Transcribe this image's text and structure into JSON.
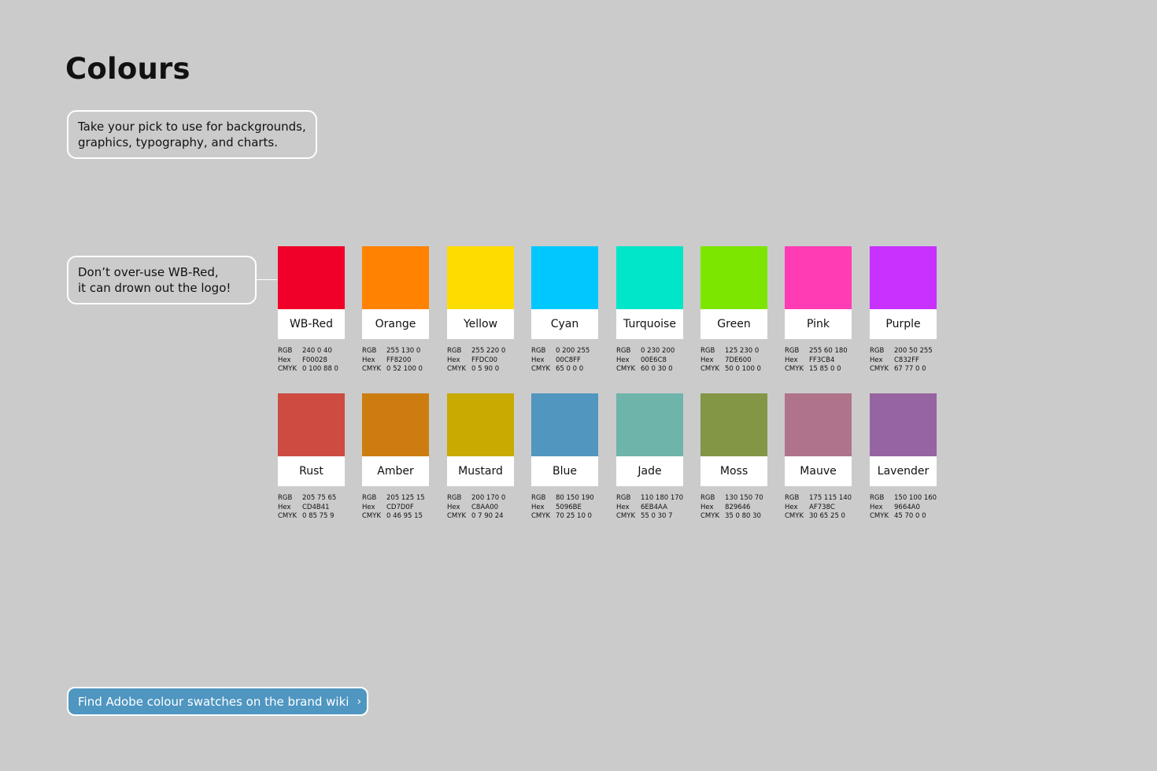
{
  "page": {
    "title": "Colours",
    "intro_lines": [
      "Take your pick to use for backgrounds,",
      "graphics, typography, and charts."
    ],
    "warning_lines": [
      "Don’t over-use WB-Red,",
      "it can drown out the logo!"
    ],
    "wiki_link": "Find Adobe colour swatches on the brand wiki",
    "wiki_chevron": "›"
  },
  "spec_labels": {
    "rgb": "RGB",
    "hex": "Hex",
    "cmyk": "CMYK"
  },
  "swatches": [
    {
      "name": "WB-Red",
      "color": "#F00028",
      "rgb": "240 0 40",
      "hex": "F00028",
      "cmyk": "0 100 88 0"
    },
    {
      "name": "Orange",
      "color": "#FF8200",
      "rgb": "255 130 0",
      "hex": "FF8200",
      "cmyk": "0 52 100 0"
    },
    {
      "name": "Yellow",
      "color": "#FFDC00",
      "rgb": "255 220 0",
      "hex": "FFDC00",
      "cmyk": "0 5 90 0"
    },
    {
      "name": "Cyan",
      "color": "#00C8FF",
      "rgb": "0 200 255",
      "hex": "00C8FF",
      "cmyk": "65 0 0 0"
    },
    {
      "name": "Turquoise",
      "color": "#00E6C8",
      "rgb": "0 230 200",
      "hex": "00E6C8",
      "cmyk": "60 0 30 0"
    },
    {
      "name": "Green",
      "color": "#7DE600",
      "rgb": "125 230 0",
      "hex": "7DE600",
      "cmyk": "50 0 100 0"
    },
    {
      "name": "Pink",
      "color": "#FF3CB4",
      "rgb": "255 60 180",
      "hex": "FF3CB4",
      "cmyk": "15 85 0 0"
    },
    {
      "name": "Purple",
      "color": "#C832FF",
      "rgb": "200 50 255",
      "hex": "C832FF",
      "cmyk": "67 77 0 0"
    },
    {
      "name": "Rust",
      "color": "#CD4B41",
      "rgb": "205 75 65",
      "hex": "CD4B41",
      "cmyk": "0 85 75 9"
    },
    {
      "name": "Amber",
      "color": "#CD7D0F",
      "rgb": "205 125 15",
      "hex": "CD7D0F",
      "cmyk": "0 46 95 15"
    },
    {
      "name": "Mustard",
      "color": "#C8AA00",
      "rgb": "200 170 0",
      "hex": "C8AA00",
      "cmyk": "0 7 90 24"
    },
    {
      "name": "Blue",
      "color": "#5096BE",
      "rgb": "80 150 190",
      "hex": "5096BE",
      "cmyk": "70 25 10 0"
    },
    {
      "name": "Jade",
      "color": "#6EB4AA",
      "rgb": "110 180 170",
      "hex": "6EB4AA",
      "cmyk": "55 0 30 7"
    },
    {
      "name": "Moss",
      "color": "#829646",
      "rgb": "130 150 70",
      "hex": "829646",
      "cmyk": "35 0 80 30"
    },
    {
      "name": "Mauve",
      "color": "#AF738C",
      "rgb": "175 115 140",
      "hex": "AF738C",
      "cmyk": "30 65 25 0"
    },
    {
      "name": "Lavender",
      "color": "#9664A0",
      "rgb": "150 100 160",
      "hex": "9664A0",
      "cmyk": "45 70 0 0"
    }
  ]
}
